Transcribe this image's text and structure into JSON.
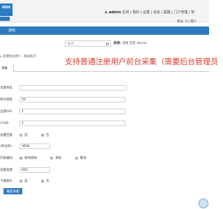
{
  "header": {
    "username": "admin",
    "links": "在线 | 我的 | 设置 | 消息 | 提醒 | 门户管理 | 管",
    "score": "积分: 0 | 用户"
  },
  "nav": {
    "label": "游戏"
  },
  "search": {
    "placeholder": "帖子",
    "hot_label": "热搜:",
    "hotwords": "活动  交友  discuz"
  },
  "breadcrumb": {
    "text": "首要找北附? › 发表帖子"
  },
  "announcement": {
    "text": "支持普通注册用户前台采集（需要后台管理员"
  },
  "tab": {
    "label": "采集"
  },
  "form": {
    "rows": [
      {
        "label": "主题地址",
        "value": ""
      },
      {
        "label": "每页搜索",
        "value": "20"
      },
      {
        "label": "主题UID",
        "value": "1"
      },
      {
        "label": "户SID",
        "value": "1"
      },
      {
        "label": "设置回复",
        "opt1": "是",
        "opt2": "否"
      },
      {
        "label": "(单位秒)",
        "value": "3600"
      },
      {
        "label": "内容编码",
        "opt1": "保持原样",
        "opt2": "简体",
        "opt3": "繁体"
      },
      {
        "label": "设置宽度",
        "value": "600"
      },
      {
        "label": "下载图片",
        "opt1": "是",
        "opt2": "否"
      }
    ],
    "submit_label": "确定采集"
  }
}
